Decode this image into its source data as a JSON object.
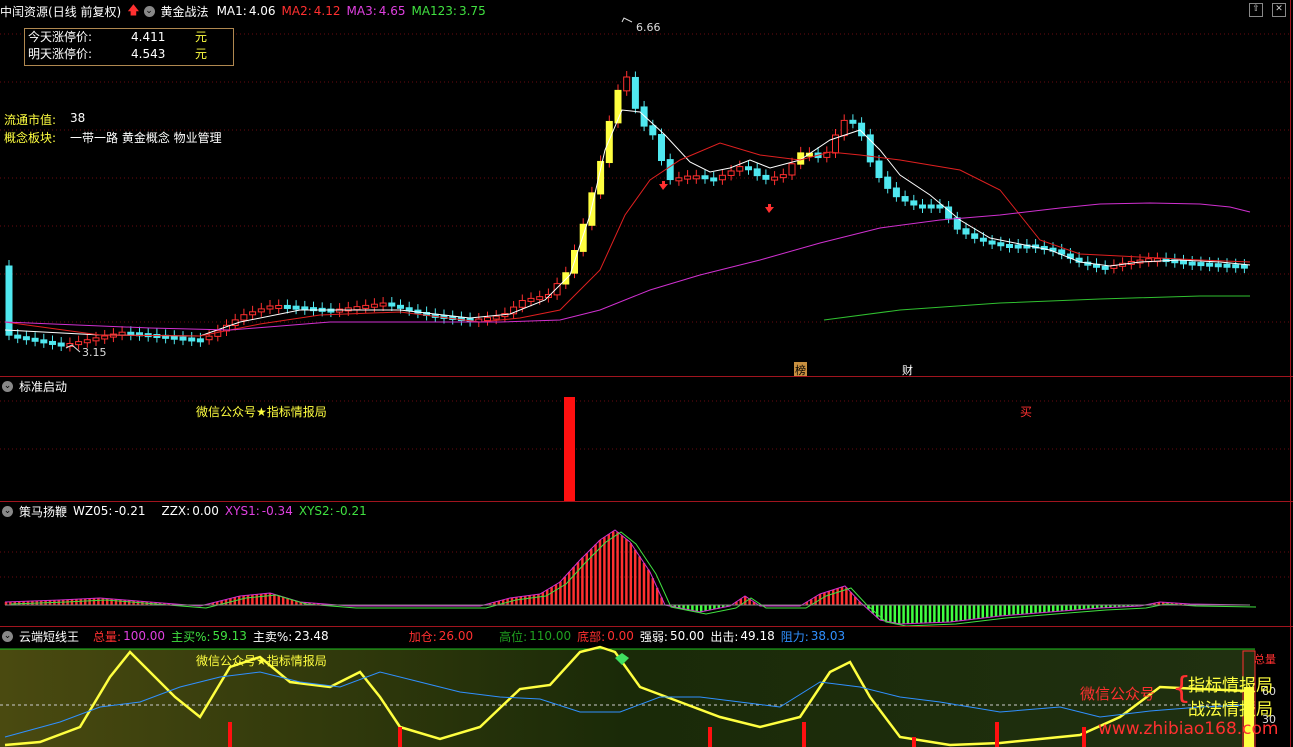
{
  "main": {
    "stock_name": "中闰资源",
    "period": "(日线 前复权)",
    "indicator": "黄金战法",
    "ma": [
      {
        "label": "MA1:",
        "value": "4.06",
        "color": "#ffffff"
      },
      {
        "label": "MA2:",
        "value": "4.12",
        "color": "#ff3030"
      },
      {
        "label": "MA3:",
        "value": "4.65",
        "color": "#e040e0"
      },
      {
        "label": "MA123:",
        "value": "3.75",
        "color": "#40e040"
      }
    ],
    "price_box": {
      "today_label": "今天涨停价:",
      "today_value": "4.411",
      "tomorrow_label": "明天涨停价:",
      "tomorrow_value": "4.543",
      "unit": "元"
    },
    "float_cap_label": "流通市值:",
    "float_cap_value": "38",
    "concept_label": "概念板块:",
    "concept_value": "一带一路 黄金概念 物业管理",
    "high_label": "6.66",
    "low_label": "3.15",
    "marker_bang": "榜",
    "marker_cai": "财"
  },
  "panel_start": {
    "title": "标准启动",
    "watermark": "微信公众号★指标情报局",
    "buy_text": "买"
  },
  "panel_cemayang": {
    "title": "策马扬鞭",
    "wz05_label": "WZ05:",
    "wz05_value": "-0.21",
    "zzx_label": "ZZX:",
    "zzx_value": "0.00",
    "xys1_label": "XYS1:",
    "xys1_value": "-0.34",
    "xys2_label": "XYS2:",
    "xys2_value": "-0.21"
  },
  "panel_yunduan": {
    "title": "云端短线王",
    "total_label": "总量:",
    "total_value": "100.00",
    "mainbuy_label": "主买%:",
    "mainbuy_value": "59.13",
    "mainsell_label": "主卖%:",
    "mainsell_value": "23.48",
    "add_label": "加仓:",
    "add_value": "26.00",
    "high_label": "高位:",
    "high_value": "110.00",
    "bottom_label": "底部:",
    "bottom_value": "0.00",
    "strength_label": "强弱:",
    "strength_value": "50.00",
    "exit_label": "出击:",
    "exit_value": "49.18",
    "resist_label": "阻力:",
    "resist_value": "38.03",
    "watermark": "微信公众号★指标情报局",
    "zonglian": "总量",
    "axis_ticks": [
      "60",
      "30"
    ],
    "overlay_wechat": "微信公众号",
    "overlay_line1": "指标情报局",
    "overlay_line2": "战法情报局",
    "url": "www.zhibiao168.com"
  },
  "colors": {
    "up": "#ff3030",
    "down": "#50e8f0",
    "yellow": "#ffff40",
    "ma_white": "#ffffff",
    "ma_red": "#e02020",
    "ma_magenta": "#d030d0",
    "ma_green": "#30c030",
    "border": "#a0141e"
  }
}
